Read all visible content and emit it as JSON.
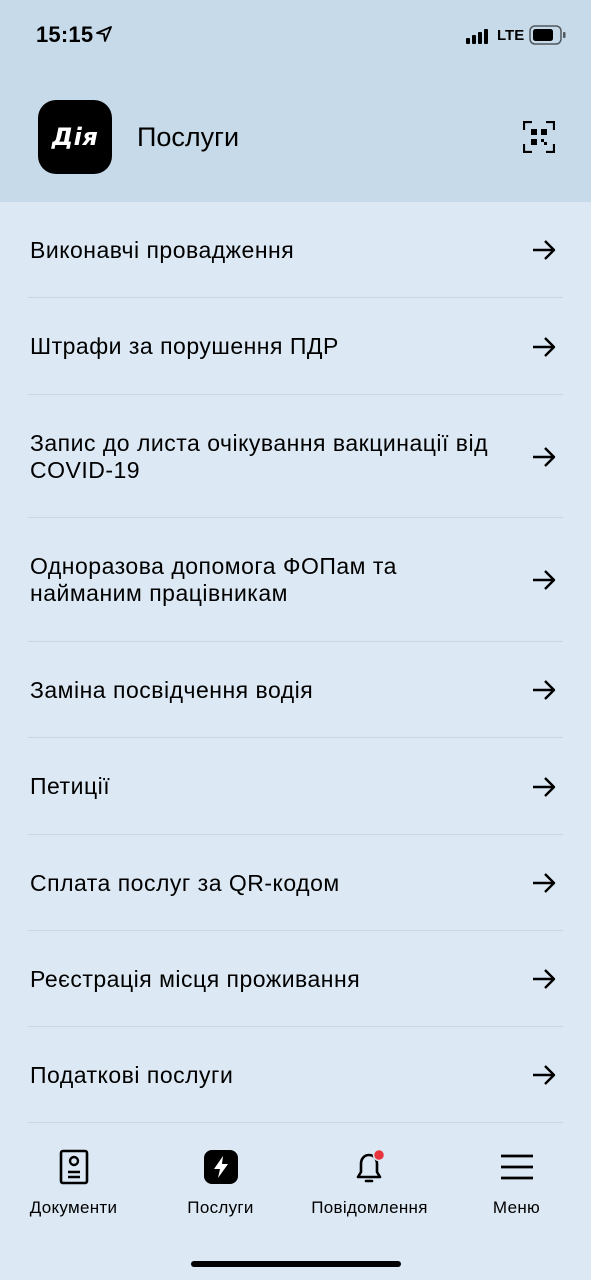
{
  "status_bar": {
    "time": "15:15",
    "network": "LTE"
  },
  "header": {
    "logo_text": "Дія",
    "title": "Послуги"
  },
  "services": [
    {
      "label": "Виконавчі провадження"
    },
    {
      "label": "Штрафи за порушення ПДР"
    },
    {
      "label": "Запис до листа очікування вакцинації від COVID-19"
    },
    {
      "label": "Одноразова допомога ФОПам та найманим працівникам"
    },
    {
      "label": "Заміна посвідчення водія"
    },
    {
      "label": "Петиції"
    },
    {
      "label": "Сплата послуг за QR-кодом"
    },
    {
      "label": "Реєстрація місця проживання"
    },
    {
      "label": "Податкові послуги"
    }
  ],
  "tabbar": {
    "documents": "Документи",
    "services": "Послуги",
    "notifications": "Повідомлення",
    "menu": "Меню"
  },
  "colors": {
    "background": "#dce8f3",
    "header_background": "#c7dae9",
    "divider": "#c9d6e2",
    "notification_dot": "#e8323c"
  }
}
